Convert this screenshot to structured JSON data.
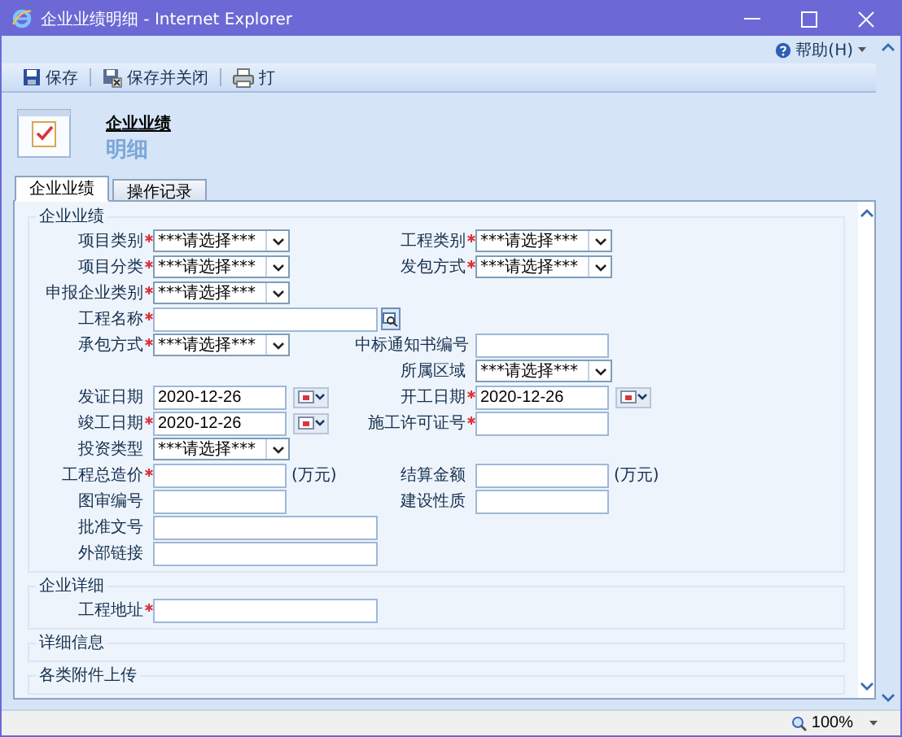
{
  "window": {
    "title": "企业业绩明细 - Internet Explorer"
  },
  "help": {
    "label": "帮助(H)"
  },
  "toolbar": [
    {
      "label": "保存",
      "kind": "save"
    },
    {
      "label": "保存并关闭",
      "kind": "save_close"
    },
    {
      "label": "打",
      "kind": "print"
    }
  ],
  "header": {
    "title": "企业业绩",
    "subtitle": "明细"
  },
  "tabs": [
    {
      "label": "企业业绩",
      "selected": true
    },
    {
      "label": "操作记录",
      "selected": false
    }
  ],
  "sections": [
    {
      "title": "企业业绩",
      "rows": [
        {
          "left": {
            "label": "项目类别",
            "required": true,
            "kind": "select",
            "value": "***请选择***"
          },
          "right": {
            "label": "工程类别",
            "required": true,
            "kind": "select",
            "value": "***请选择***"
          }
        },
        {
          "left": {
            "label": "项目分类",
            "required": true,
            "kind": "select",
            "value": "***请选择***"
          },
          "right": {
            "label": "发包方式",
            "required": true,
            "kind": "select",
            "value": "***请选择***"
          }
        },
        {
          "left": {
            "label": "申报企业类别",
            "required": true,
            "kind": "select",
            "value": "***请选择***"
          }
        },
        {
          "left": {
            "label": "工程名称",
            "required": true,
            "kind": "lookup"
          }
        },
        {
          "left": {
            "label": "承包方式",
            "required": true,
            "kind": "select",
            "value": "***请选择***"
          },
          "right": {
            "label": "中标通知书编号",
            "required": false,
            "kind": "text"
          }
        },
        {
          "right": {
            "label": "所属区域",
            "required": false,
            "kind": "select",
            "value": "***请选择***"
          }
        },
        {
          "left": {
            "label": "发证日期",
            "required": false,
            "kind": "date",
            "value": "2020-12-26"
          },
          "right": {
            "label": "开工日期",
            "required": true,
            "kind": "date",
            "value": "2020-12-26"
          }
        },
        {
          "left": {
            "label": "竣工日期",
            "required": true,
            "kind": "date",
            "value": "2020-12-26"
          },
          "right": {
            "label": "施工许可证号",
            "required": true,
            "kind": "text"
          }
        },
        {
          "left": {
            "label": "投资类型",
            "required": false,
            "kind": "select",
            "value": "***请选择***"
          }
        },
        {
          "left": {
            "label": "工程总造价",
            "required": true,
            "kind": "text",
            "unit": "(万元)"
          },
          "right": {
            "label": "结算金额",
            "required": false,
            "kind": "text",
            "unit": "(万元)"
          }
        },
        {
          "left": {
            "label": "图审编号",
            "required": false,
            "kind": "text"
          },
          "right": {
            "label": "建设性质",
            "required": false,
            "kind": "text"
          }
        },
        {
          "left": {
            "label": "批准文号",
            "required": false,
            "kind": "long_text"
          }
        },
        {
          "left": {
            "label": "外部链接",
            "required": false,
            "kind": "long_text"
          }
        }
      ]
    },
    {
      "title": "企业详细",
      "rows": [
        {
          "left": {
            "label": "工程地址",
            "required": true,
            "kind": "long_text"
          }
        }
      ]
    },
    {
      "title": "详细信息"
    },
    {
      "title": "各类附件上传"
    }
  ],
  "status_bar": {
    "zoom": "100%"
  }
}
